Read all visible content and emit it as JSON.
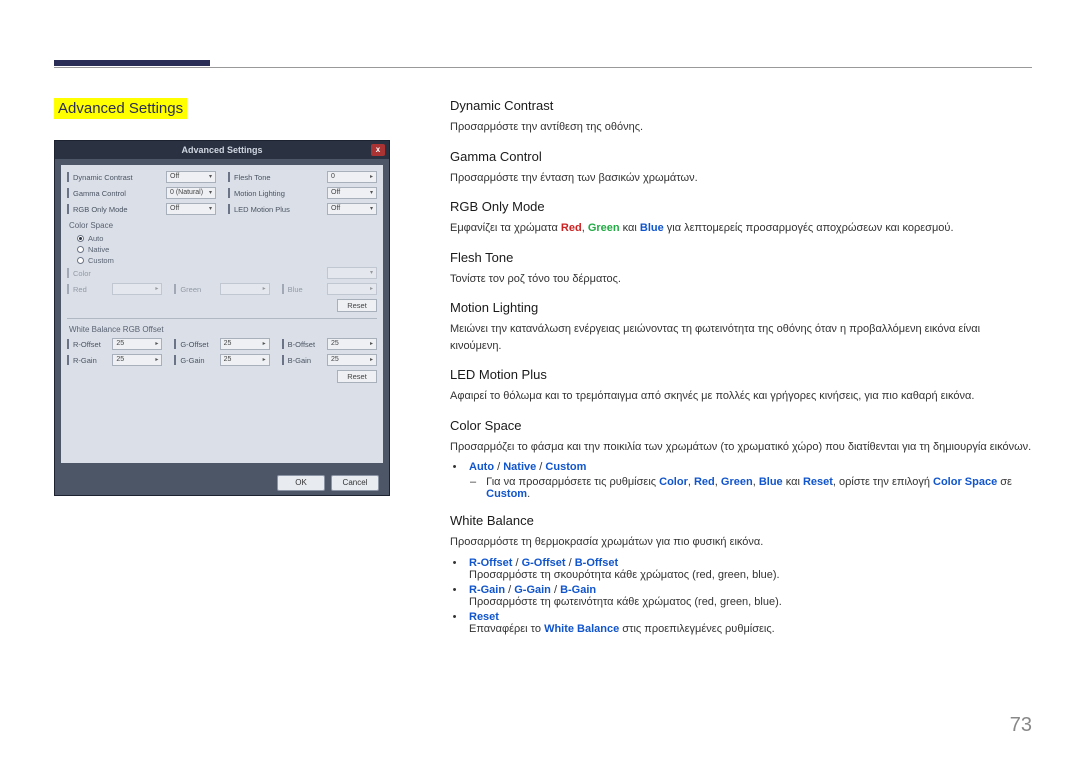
{
  "page_number": "73",
  "page_title": "Advanced Settings",
  "dialog": {
    "title": "Advanced Settings",
    "close": "x",
    "row1": [
      {
        "label": "Dynamic Contrast",
        "value": "Off"
      },
      {
        "label": "Flesh Tone",
        "value": "0"
      }
    ],
    "row2": [
      {
        "label": "Gamma Control",
        "value": "0 (Natural)"
      },
      {
        "label": "Motion Lighting",
        "value": "Off"
      }
    ],
    "row3": [
      {
        "label": "RGB Only Mode",
        "value": "Off"
      },
      {
        "label": "LED Motion Plus",
        "value": "Off"
      }
    ],
    "color_space": {
      "label": "Color Space",
      "opts": [
        "Auto",
        "Native",
        "Custom"
      ],
      "selected": "Auto",
      "sub": [
        {
          "label": "Color",
          "value": ""
        },
        {
          "label": "Red",
          "value": ""
        },
        {
          "label": "Green",
          "value": ""
        },
        {
          "label": "Blue",
          "value": ""
        }
      ],
      "reset": "Reset"
    },
    "wb": {
      "label": "White Balance RGB Offset",
      "items": [
        {
          "label": "R-Offset",
          "value": "25"
        },
        {
          "label": "G-Offset",
          "value": "25"
        },
        {
          "label": "B-Offset",
          "value": "25"
        },
        {
          "label": "R-Gain",
          "value": "25"
        },
        {
          "label": "G-Gain",
          "value": "25"
        },
        {
          "label": "B-Gain",
          "value": "25"
        }
      ],
      "reset": "Reset"
    },
    "ok": "OK",
    "cancel": "Cancel"
  },
  "sections": {
    "dyn": {
      "title": "Dynamic Contrast",
      "body": "Προσαρμόστε την αντίθεση της οθόνης."
    },
    "gamma": {
      "title": "Gamma Control",
      "body": "Προσαρμόστε την ένταση των βασικών χρωμάτων."
    },
    "rgb": {
      "title": "RGB Only Mode",
      "body_pre": "Εμφανίζει τα χρώματα ",
      "r": "Red",
      "g": "Green",
      "b": "Blue",
      "body_post": " για λεπτομερείς προσαρμογές αποχρώσεων και κορεσμού.",
      "and": " και ",
      "comma": ", "
    },
    "flesh": {
      "title": "Flesh Tone",
      "body": "Τονίστε τον ροζ τόνο του δέρματος."
    },
    "motion": {
      "title": "Motion Lighting",
      "body": "Μειώνει την κατανάλωση ενέργειας μειώνοντας τη φωτεινότητα της οθόνης όταν η προβαλλόμενη εικόνα είναι κινούμενη."
    },
    "led": {
      "title": "LED Motion Plus",
      "body": "Αφαιρεί το θόλωμα και το τρεμόπαιγμα από σκηνές με πολλές και γρήγορες κινήσεις, για πιο καθαρή εικόνα."
    },
    "cs": {
      "title": "Color Space",
      "body": "Προσαρμόζει το φάσμα και την ποικιλία των χρωμάτων (το χρωματικό χώρο) που διατίθενται για τη δημιουργία εικόνων.",
      "b1_auto": "Auto",
      "b1_native": "Native",
      "b1_custom": "Custom",
      "slash": " / ",
      "b2_dash": "–",
      "b2_pre": "Για να προσαρμόσετε τις ρυθμίσεις ",
      "b2_labels": [
        "Color",
        "Red",
        "Green",
        "Blue",
        "Reset"
      ],
      "b2_mid": ", ορίστε την επιλογή ",
      "b2_space": "Color Space",
      "b2_end": " σε ",
      "b2_custom": "Custom",
      "dot": "."
    },
    "wb": {
      "title": "White Balance",
      "body": "Προσαρμόστε τη θερμοκρασία χρωμάτων για πιο φυσική εικόνα.",
      "b1": [
        "R-Offset",
        "G-Offset",
        "B-Offset"
      ],
      "b1_txt": "Προσαρμόστε τη σκουρότητα κάθε χρώματος (red, green, blue).",
      "b2": [
        "R-Gain",
        "G-Gain",
        "B-Gain"
      ],
      "b2_txt": "Προσαρμόστε τη φωτεινότητα κάθε χρώματος (red, green, blue).",
      "b3": "Reset",
      "b3_pre": "Επαναφέρει το ",
      "b3_wb": "White Balance",
      "b3_post": " στις προεπιλεγμένες ρυθμίσεις.",
      "slash": " / "
    }
  }
}
